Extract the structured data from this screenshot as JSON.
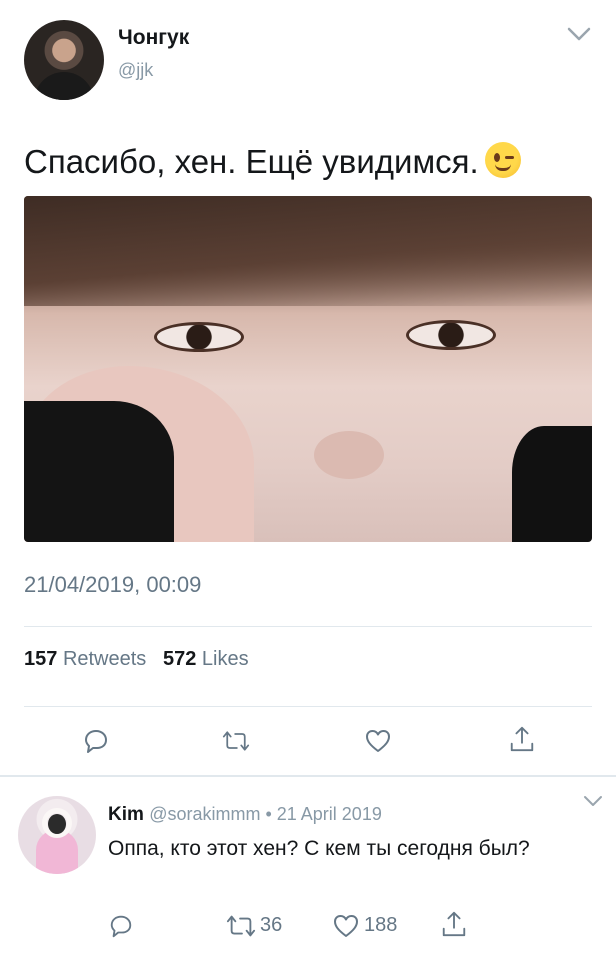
{
  "tweet": {
    "author_name": "Чонгук",
    "author_handle": "@jjk",
    "text": "Спасибо, хен. Ещё увидимся.",
    "emoji": "wink-emoji",
    "timestamp": "21/04/2019, 00:09",
    "retweets_count": "157",
    "retweets_label": "Retweets",
    "likes_count": "572",
    "likes_label": "Likes"
  },
  "reply": {
    "author_name": "Kim",
    "meta": "@sorakimmm • 21 April 2019",
    "text": "Оппа, кто этот хен? С кем ты сегодня был?",
    "retweet_count": "36",
    "like_count": "188"
  },
  "icons": {
    "chevron": "chevron-down-icon",
    "reply": "reply-icon",
    "retweet": "retweet-icon",
    "like": "heart-icon",
    "share": "share-icon"
  },
  "colors": {
    "text_primary": "#14171a",
    "text_secondary": "#657786",
    "icon": "#657786",
    "divider": "#e1e8ed"
  }
}
